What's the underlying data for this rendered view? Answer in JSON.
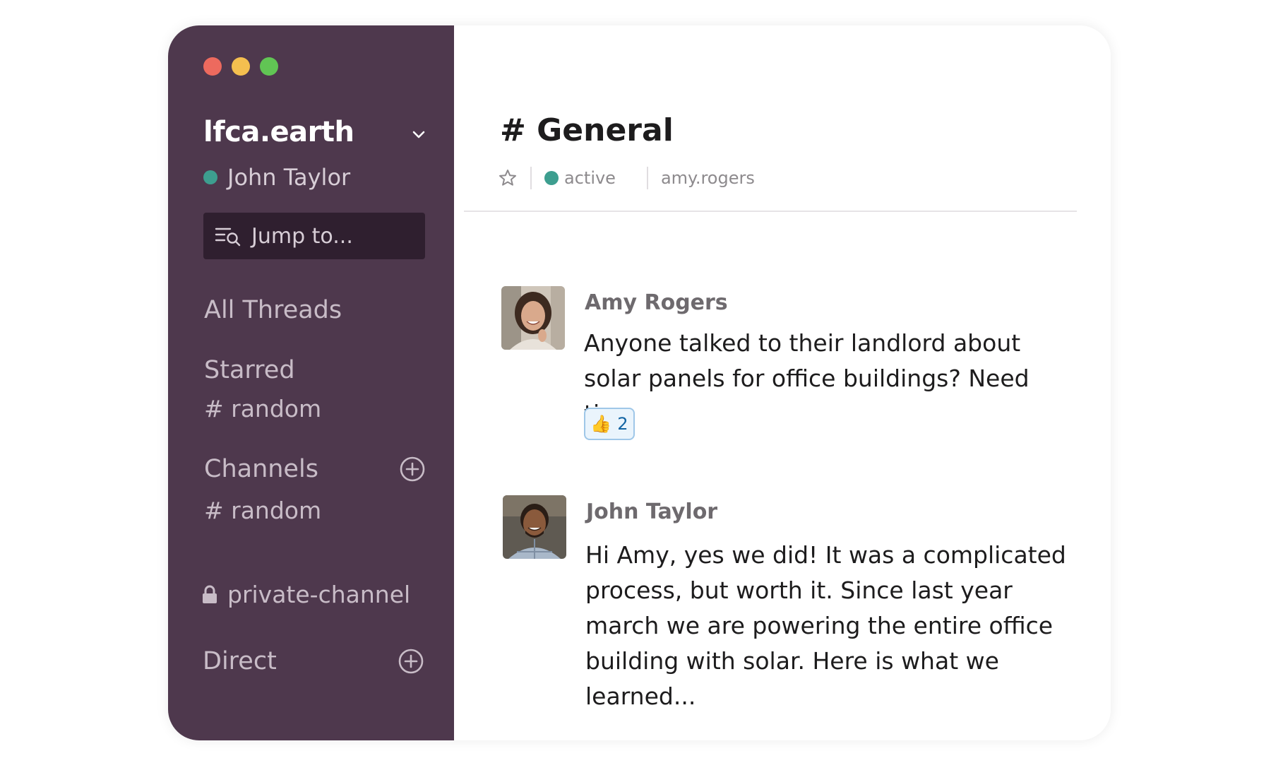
{
  "window": {
    "traffic_colors": [
      "#ed6a5e",
      "#f4bf4f",
      "#61c554"
    ]
  },
  "sidebar": {
    "workspace_name": "lfca.earth",
    "current_user": "John Taylor",
    "jump_placeholder": "Jump to...",
    "all_threads": "All Threads",
    "starred_label": "Starred",
    "starred_items": [
      "# random"
    ],
    "channels_label": "Channels",
    "channel_items": [
      "# random"
    ],
    "private_channel": "private-channel",
    "direct_label": "Direct",
    "bg_color": "#4e384d"
  },
  "header": {
    "channel_title": "# General",
    "status": "active",
    "member": "amy.rogers"
  },
  "messages": [
    {
      "author": "Amy Rogers",
      "text": "Anyone talked to their landlord about solar panels for office buildings? Need tips.",
      "reaction_emoji": "👍",
      "reaction_count": "2"
    },
    {
      "author": "John Taylor",
      "text": "Hi Amy, yes we did! It was a complicated process, but worth it. Since last year march we are powering the entire office building with solar. Here is what we learned..."
    }
  ]
}
